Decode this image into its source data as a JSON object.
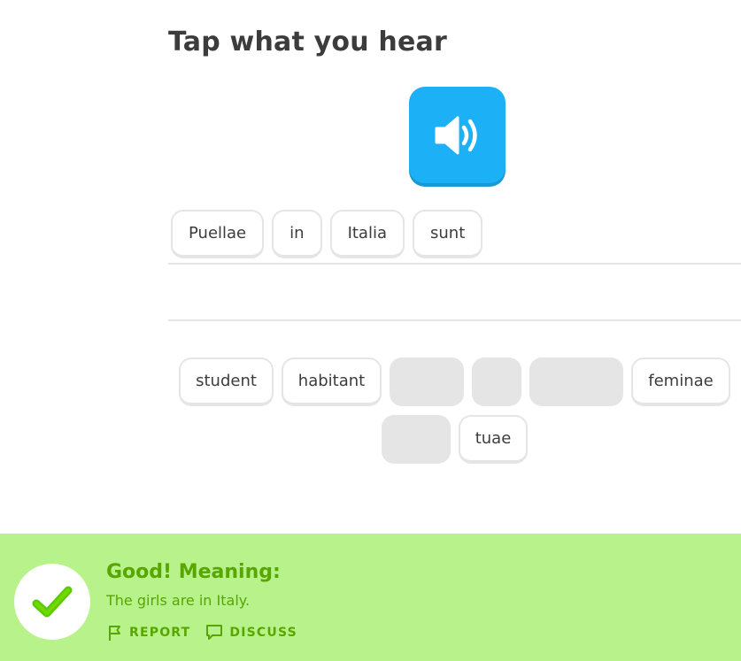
{
  "header": {
    "title": "Tap what you hear"
  },
  "audio": {
    "icon": "speaker-icon"
  },
  "answer": {
    "tiles": [
      "Puellae",
      "in",
      "Italia",
      "sunt"
    ]
  },
  "bank": {
    "row1": [
      {
        "label": "student",
        "used": false
      },
      {
        "label": "habitant",
        "used": false
      },
      {
        "label": "",
        "used": true
      },
      {
        "label": "",
        "used": true
      },
      {
        "label": "",
        "used": true
      },
      {
        "label": "feminae",
        "used": false
      }
    ],
    "row2": [
      {
        "label": "",
        "used": true
      },
      {
        "label": "tuae",
        "used": false
      }
    ]
  },
  "feedback": {
    "title": "Good! Meaning:",
    "meaning": "The girls are in Italy.",
    "report_label": "REPORT",
    "discuss_label": "DISCUSS",
    "colors": {
      "background": "#b8f28b",
      "text": "#58a700"
    }
  }
}
